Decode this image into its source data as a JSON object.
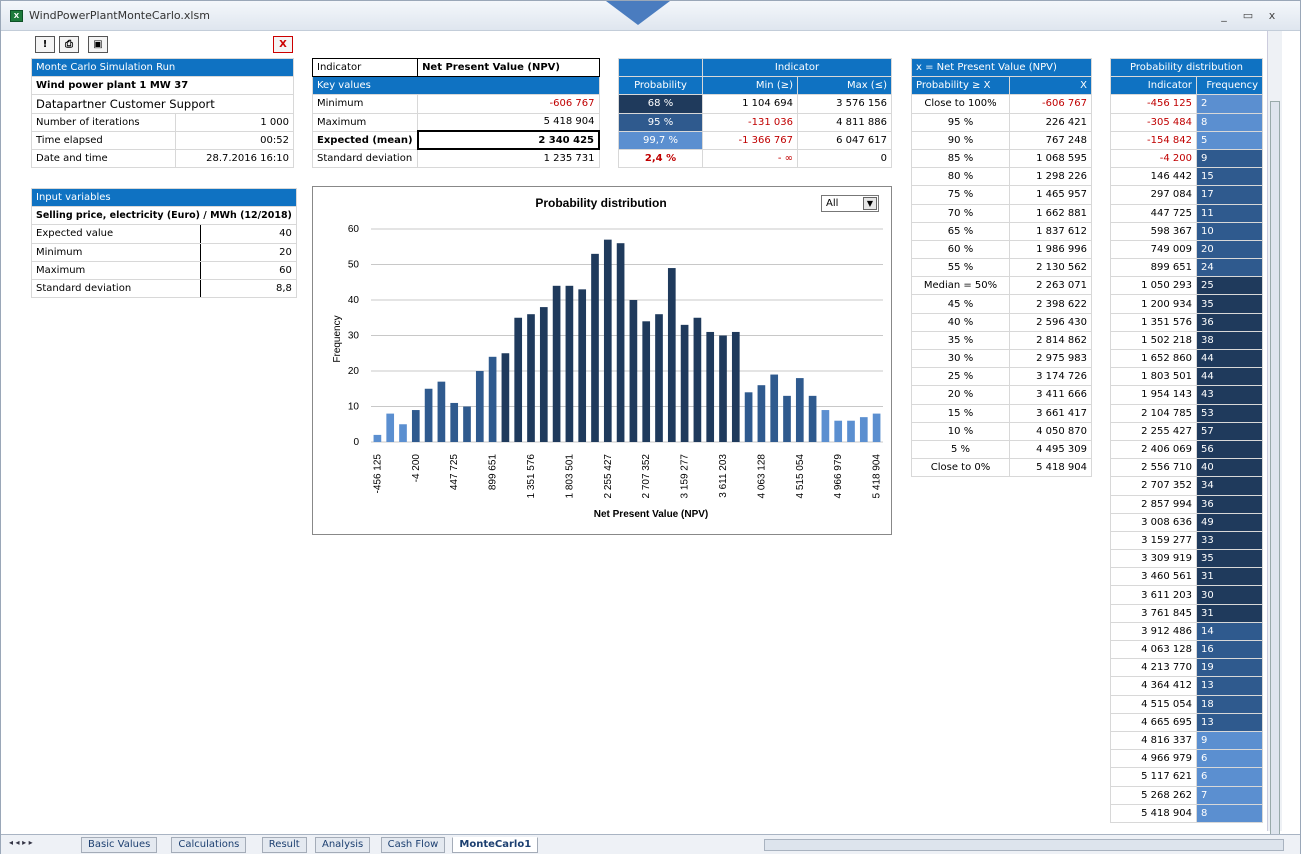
{
  "window": {
    "title": "WindPowerPlantMonteCarlo.xlsm",
    "minimize": "_",
    "restore": "▭",
    "close": "x"
  },
  "toolbar": {
    "warn": "!",
    "print": "⎙",
    "camera": "▣",
    "close": "X"
  },
  "run": {
    "header": "Monte Carlo Simulation Run",
    "name": "Wind power plant 1 MW 37",
    "company": "Datapartner Customer Support",
    "rows": [
      {
        "label": "Number of iterations",
        "value": "1 000"
      },
      {
        "label": "Time elapsed",
        "value": "00:52"
      },
      {
        "label": "Date and time",
        "value": "28.7.2016 16:10"
      }
    ]
  },
  "input": {
    "header": "Input variables",
    "title": "Selling price, electricity (Euro) / MWh (12/2018)",
    "rows": [
      {
        "label": "Expected value",
        "value": "40"
      },
      {
        "label": "Minimum",
        "value": "20"
      },
      {
        "label": "Maximum",
        "value": "60"
      },
      {
        "label": "Standard deviation",
        "value": "8,8"
      }
    ]
  },
  "keyvals": {
    "indicator_label": "Indicator",
    "indicator_value": "Net Present Value (NPV)",
    "header": "Key values",
    "rows": [
      {
        "label": "Minimum",
        "value": "-606 767"
      },
      {
        "label": "Maximum",
        "value": "5 418 904"
      },
      {
        "label": "Expected (mean)",
        "value": "2 340 425"
      },
      {
        "label": "Standard deviation",
        "value": "1 235 731"
      }
    ]
  },
  "probtbl": {
    "indicator": "Indicator",
    "cols": [
      "Probability",
      "Min (≥)",
      "Max (≤)"
    ],
    "rows": [
      {
        "p": "68 %",
        "min": "1 104 694",
        "max": "3 576 156"
      },
      {
        "p": "95 %",
        "min": "-131 036",
        "max": "4 811 886"
      },
      {
        "p": "99,7 %",
        "min": "-1 366 767",
        "max": "6 047 617"
      },
      {
        "p": "2,4 %",
        "min": "- ∞",
        "max": "0"
      }
    ],
    "colors": [
      "#1f3a5c",
      "#2f5a8e",
      "#5b8fd0"
    ]
  },
  "xtbl": {
    "header": "x = Net Present Value (NPV)",
    "cols": [
      "Probability ≥ X",
      "X"
    ],
    "rows": [
      [
        "Close to 100%",
        "-606 767"
      ],
      [
        "95 %",
        "226 421"
      ],
      [
        "90 %",
        "767 248"
      ],
      [
        "85 %",
        "1 068 595"
      ],
      [
        "80 %",
        "1 298 226"
      ],
      [
        "75 %",
        "1 465 957"
      ],
      [
        "70 %",
        "1 662 881"
      ],
      [
        "65 %",
        "1 837 612"
      ],
      [
        "60 %",
        "1 986 996"
      ],
      [
        "55 %",
        "2 130 562"
      ],
      [
        "Median = 50%",
        "2 263 071"
      ],
      [
        "45 %",
        "2 398 622"
      ],
      [
        "40 %",
        "2 596 430"
      ],
      [
        "35 %",
        "2 814 862"
      ],
      [
        "30 %",
        "2 975 983"
      ],
      [
        "25 %",
        "3 174 726"
      ],
      [
        "20 %",
        "3 411 666"
      ],
      [
        "15 %",
        "3 661 417"
      ],
      [
        "10 %",
        "4 050 870"
      ],
      [
        "5 %",
        "4 495 309"
      ],
      [
        "Close to 0%",
        "5 418 904"
      ]
    ]
  },
  "disttbl": {
    "header": "Probability distribution",
    "cols": [
      "Indicator",
      "Frequency"
    ],
    "rows": [
      [
        "-456 125",
        "2"
      ],
      [
        "-305 484",
        "8"
      ],
      [
        "-154 842",
        "5"
      ],
      [
        "-4 200",
        "9"
      ],
      [
        "146 442",
        "15"
      ],
      [
        "297 084",
        "17"
      ],
      [
        "447 725",
        "11"
      ],
      [
        "598 367",
        "10"
      ],
      [
        "749 009",
        "20"
      ],
      [
        "899 651",
        "24"
      ],
      [
        "1 050 293",
        "25"
      ],
      [
        "1 200 934",
        "35"
      ],
      [
        "1 351 576",
        "36"
      ],
      [
        "1 502 218",
        "38"
      ],
      [
        "1 652 860",
        "44"
      ],
      [
        "1 803 501",
        "44"
      ],
      [
        "1 954 143",
        "43"
      ],
      [
        "2 104 785",
        "53"
      ],
      [
        "2 255 427",
        "57"
      ],
      [
        "2 406 069",
        "56"
      ],
      [
        "2 556 710",
        "40"
      ],
      [
        "2 707 352",
        "34"
      ],
      [
        "2 857 994",
        "36"
      ],
      [
        "3 008 636",
        "49"
      ],
      [
        "3 159 277",
        "33"
      ],
      [
        "3 309 919",
        "35"
      ],
      [
        "3 460 561",
        "31"
      ],
      [
        "3 611 203",
        "30"
      ],
      [
        "3 761 845",
        "31"
      ],
      [
        "3 912 486",
        "14"
      ],
      [
        "4 063 128",
        "16"
      ],
      [
        "4 213 770",
        "19"
      ],
      [
        "4 364 412",
        "13"
      ],
      [
        "4 515 054",
        "18"
      ],
      [
        "4 665 695",
        "13"
      ],
      [
        "4 816 337",
        "9"
      ],
      [
        "4 966 979",
        "6"
      ],
      [
        "5 117 621",
        "6"
      ],
      [
        "5 268 262",
        "7"
      ],
      [
        "5 418 904",
        "8"
      ]
    ]
  },
  "chart_data": {
    "type": "bar",
    "title": "Probability distribution",
    "xlabel": "Net Present Value (NPV)",
    "ylabel": "Frequency",
    "ylim": [
      0,
      60
    ],
    "yticks": [
      0,
      10,
      20,
      30,
      40,
      50,
      60
    ],
    "dropdown": "All",
    "categories": [
      "-456 125",
      "-305 484",
      "-154 842",
      "-4 200",
      "146 442",
      "297 084",
      "447 725",
      "598 367",
      "749 009",
      "899 651",
      "1 050 293",
      "1 200 934",
      "1 351 576",
      "1 502 218",
      "1 652 860",
      "1 803 501",
      "1 954 143",
      "2 104 785",
      "2 255 427",
      "2 406 069",
      "2 556 710",
      "2 707 352",
      "2 857 994",
      "3 008 636",
      "3 159 277",
      "3 309 919",
      "3 460 561",
      "3 611 203",
      "3 761 845",
      "3 912 486",
      "4 063 128",
      "4 213 770",
      "4 364 412",
      "4 515 054",
      "4 665 695",
      "4 816 337",
      "4 966 979",
      "5 117 621",
      "5 268 262",
      "5 418 904"
    ],
    "values": [
      2,
      8,
      5,
      9,
      15,
      17,
      11,
      10,
      20,
      24,
      25,
      35,
      36,
      38,
      44,
      44,
      43,
      53,
      57,
      56,
      40,
      34,
      36,
      49,
      33,
      35,
      31,
      30,
      31,
      14,
      16,
      19,
      13,
      18,
      13,
      9,
      6,
      6,
      7,
      8
    ],
    "tick_labels": [
      "-456 125",
      "-4 200",
      "447 725",
      "899 651",
      "1 351 576",
      "1 803 501",
      "2 255 427",
      "2 707 352",
      "3 159 277",
      "3 611 203",
      "4 063 128",
      "4 515 054",
      "4 966 979",
      "5 418 904"
    ],
    "colors": {
      "tail": "#5b8fd0",
      "mid": "#2f5a8e",
      "core": "#1f3a5c"
    }
  },
  "tabs": [
    "Basic Values",
    "Calculations",
    "Result",
    "Analysis",
    "Cash Flow",
    "MonteCarlo1"
  ],
  "nav": "◂ ◂ ▸ ▸"
}
